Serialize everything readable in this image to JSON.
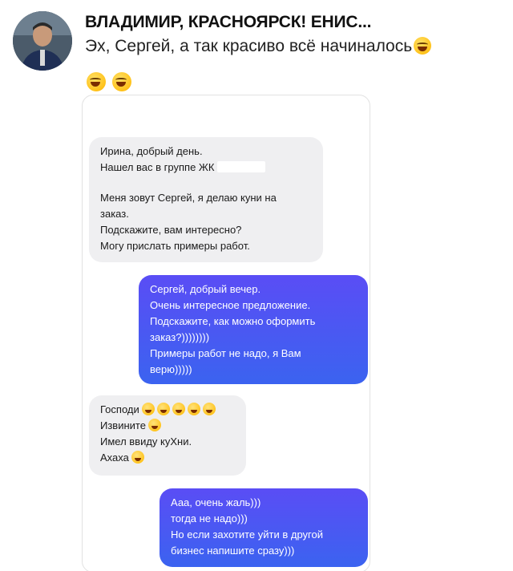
{
  "post": {
    "author": "ВЛАДИМИР, КРАСНОЯРСК! ЕНИС...",
    "caption": "Эх, Сергей, а так красиво всё начиналось",
    "emoji_icons": [
      "rolling-on-floor-laughing-icon",
      "rolling-on-floor-laughing-icon",
      "rolling-on-floor-laughing-icon"
    ]
  },
  "chat": {
    "messages": [
      {
        "direction": "incoming",
        "lines": [
          "Ирина, добрый день.",
          "Нашел вас в группе ЖК",
          "",
          "Меня зовут Сергей, я делаю куни на",
          "заказ.",
          "Подскажите, вам интересно?",
          "Могу прислать примеры работ."
        ]
      },
      {
        "direction": "outgoing",
        "lines": [
          "Сергей, добрый вечер.",
          "Очень интересное предложение.",
          "Подскажите, как можно оформить",
          "заказ?))))))))",
          "Примеры работ не надо, я Вам",
          "верю)))))"
        ]
      },
      {
        "direction": "incoming",
        "lines": [
          "Господи",
          "Извините",
          "Имел ввиду куХни.",
          "Ахаха"
        ],
        "emoji_icons": [
          "grinning-sweat-icon",
          "zany-face-icon",
          "crying-cat-icon"
        ]
      },
      {
        "direction": "outgoing",
        "lines": [
          "Ааа, очень жаль)))",
          "тогда не надо)))",
          "Но если захотите уйти в другой",
          "бизнес напишите сразу)))"
        ]
      }
    ]
  },
  "colors": {
    "incoming_bubble": "#efeff1",
    "outgoing_bubble_top": "#5a4df5",
    "outgoing_bubble_bottom": "#3b63f0"
  }
}
